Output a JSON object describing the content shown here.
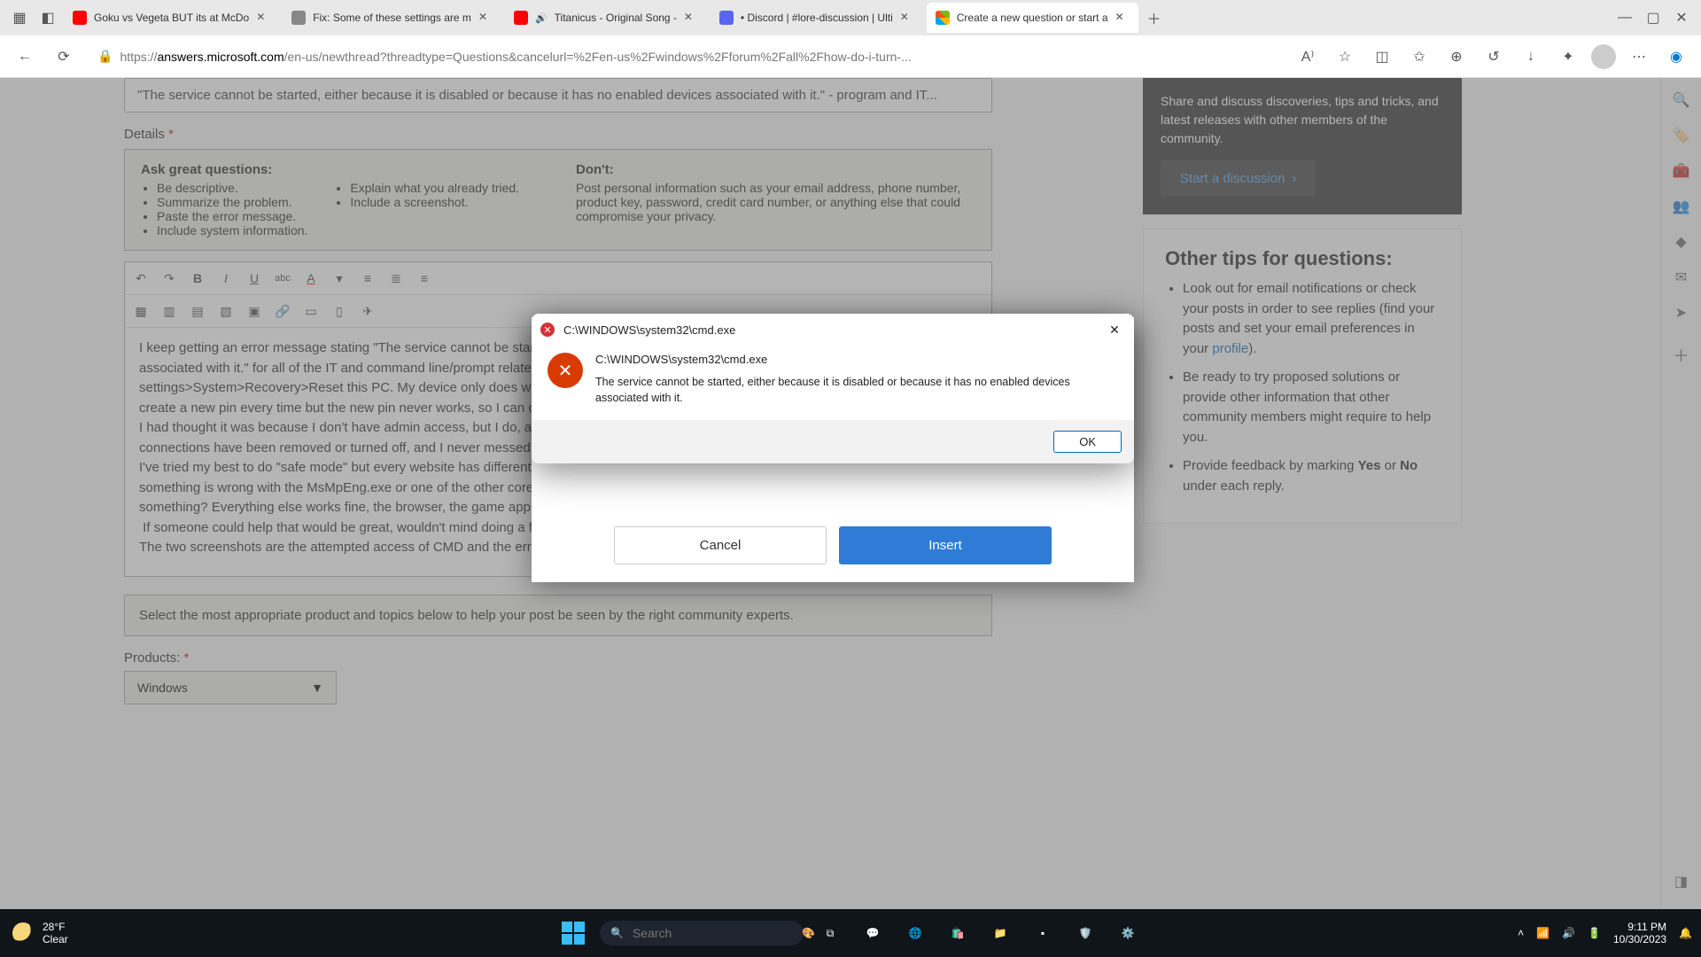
{
  "browser": {
    "tabs": [
      {
        "label": "Goku vs Vegeta BUT its at McDo"
      },
      {
        "label": "Fix: Some of these settings are m"
      },
      {
        "label": "Titanicus - Original Song - "
      },
      {
        "label": "• Discord | #lore-discussion | Ulti"
      },
      {
        "label": "Create a new question or start a"
      }
    ],
    "url_prefix": "https://",
    "url_host": "answers.microsoft.com",
    "url_path": "/en-us/newthread?threadtype=Questions&cancelurl=%2Fen-us%2Fwindows%2Fforum%2Fall%2Fhow-do-i-turn-..."
  },
  "page": {
    "title_input": "\"The service cannot be started, either because it is disabled or because it has no enabled devices associated with it.\" - program and IT...",
    "details_label": "Details",
    "tips_h1": "Ask great questions:",
    "tips_list": [
      "Be descriptive.",
      "Summarize the problem.",
      "Paste the error message.",
      "Include system information."
    ],
    "tips_list2": [
      "Explain what you already tried.",
      "Include a screenshot."
    ],
    "dont_h": "Don't:",
    "dont_text": "Post personal information such as your email address, phone number, product key, password, credit card number, or anything else that could compromise your privacy.",
    "body_text": "I keep getting an error message stating \"The service cannot be started, either because it is disabled or because it has no enabled devices associated with it.\" for all of the IT and command line/prompt related apps on my PC, including CMD, PowerShell, Troubleshoot, settings>System>Recovery>Reset this PC. My device only does windows hello log ins, so I tried to unlink my pin code, and I'm forced to create a new pin every time but the new pin never works, so I can only log in with my password.\nI had thought it was because I don't have admin access, but I do, and my one other admin I had made for testing stuff was deleted. My remote connections have been removed or turned off, and I never messed with BitLocker or encryption.\nI've tried my best to do \"safe mode\" but every website has different instructions and none work, is there a definitive way to do it? My theory is something is wrong with the MsMpEng.exe or one of the other core systems, or for some reason everything is dis-synced with the device or something? Everything else works fine, the browser, the game apps, Steam, Paradox app, Wi-fi, ect, all work fine.\n If someone could help that would be great, wouldn't mind doing a full reset but IDK how to do that.\nThe two screenshots are the attempted access of CMD and the error result",
    "helper_text": "Select the most appropriate product and topics below to help your post be seen by the right community experts.",
    "products_label": "Products:",
    "product_selected": "Windows"
  },
  "sidebar": {
    "dark_text": "Share and discuss discoveries, tips and tricks, and latest releases with other members of the community.",
    "start_btn": "Start a discussion",
    "tips_h": "Other tips for questions:",
    "tip1_a": "Look out for email notifications or check your posts in order to see replies (find your posts and set your email preferences in your ",
    "tip1_link": "profile",
    "tip1_b": ").",
    "tip2": "Be ready to try proposed solutions or provide other information that other community members might require to help you.",
    "tip3_a": "Provide feedback by marking ",
    "tip3_yes": "Yes",
    "tip3_or": " or ",
    "tip3_no": "No",
    "tip3_b": " under each reply."
  },
  "insert_modal": {
    "cancel": "Cancel",
    "insert": "Insert"
  },
  "dialog": {
    "title": "C:\\WINDOWS\\system32\\cmd.exe",
    "heading": "C:\\WINDOWS\\system32\\cmd.exe",
    "message": "The service cannot be started, either because it is disabled or because it has no enabled devices associated with it.",
    "ok": "OK"
  },
  "taskbar": {
    "temp": "28°F",
    "cond": "Clear",
    "search_placeholder": "Search",
    "time": "9:11 PM",
    "date": "10/30/2023"
  }
}
